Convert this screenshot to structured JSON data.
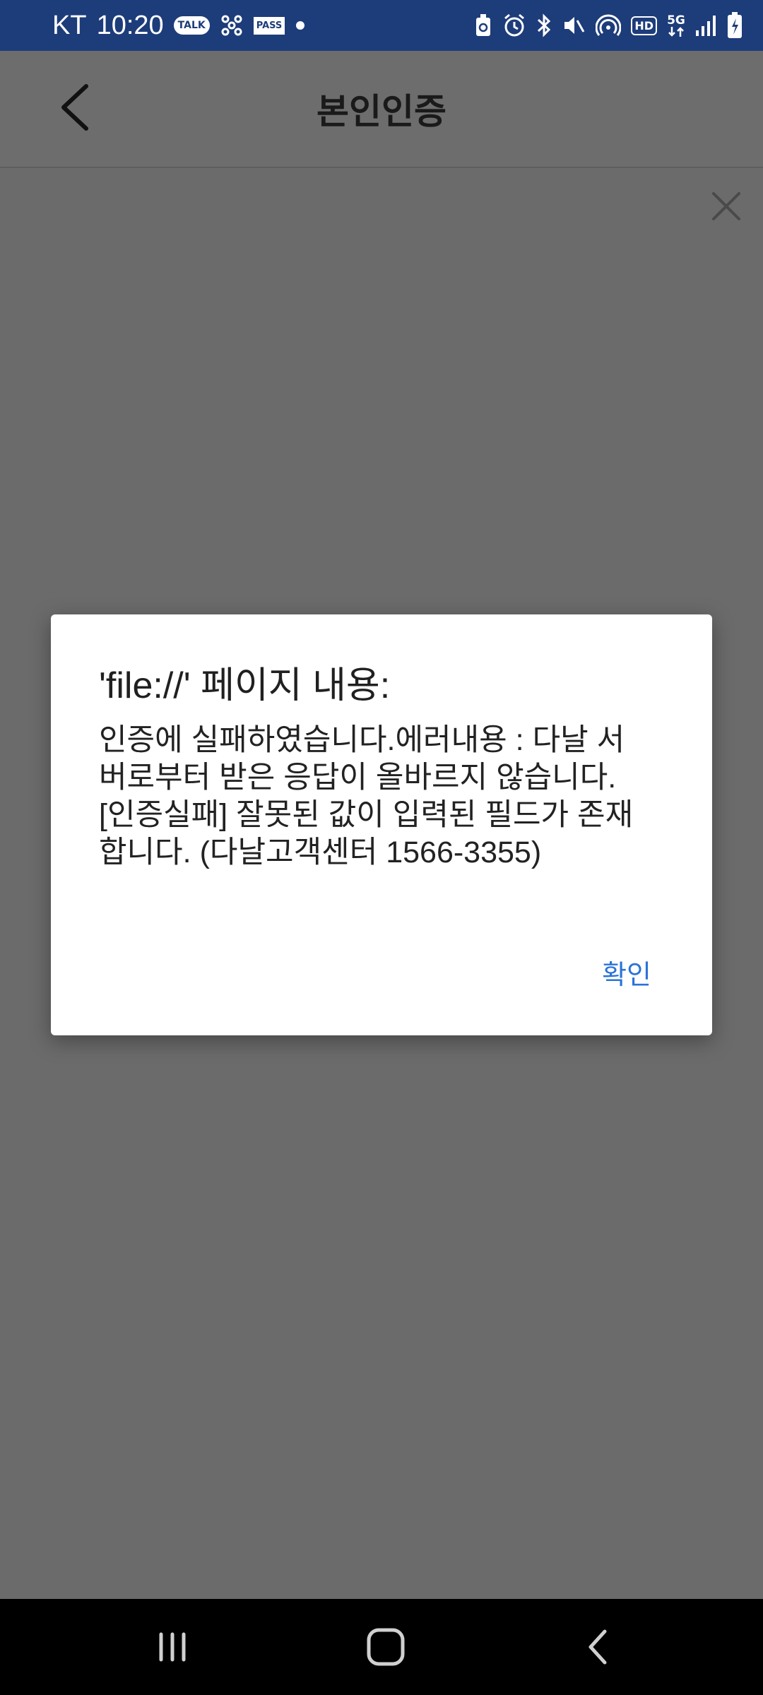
{
  "status_bar": {
    "carrier": "KT",
    "time": "10:20",
    "left_icons": [
      "kakaotalk-icon",
      "network-icon",
      "pass-icon",
      "dot-icon"
    ],
    "kakao_label": "TALK",
    "pass_label": "PASS",
    "right_icons": [
      "recycle-icon",
      "alarm-icon",
      "bluetooth-icon",
      "vibrate-icon",
      "hotspot-icon",
      "hd-icon",
      "5g-icon",
      "signal-icon",
      "battery-icon"
    ],
    "hd_label": "HD",
    "fiveg_label": "5G"
  },
  "header": {
    "title": "본인인증",
    "back_icon": "chevron-left-icon",
    "close_icon": "close-icon"
  },
  "dialog": {
    "title": "'file://' 페이지 내용:",
    "message": "인증에 실패하였습니다.에러내용 : 다날 서버로부터 받은 응답이 올바르지 않습니다.[인증실패] 잘못된 값이 입력된 필드가 존재합니다. (다날고객센터 1566-3355)",
    "ok_label": "확인"
  },
  "nav_bar": {
    "items": [
      "recent-apps-icon",
      "home-icon",
      "back-icon"
    ]
  },
  "colors": {
    "status_bar": "#1d3c7a",
    "overlay": "#6b6b6b",
    "accent": "#2a73d9"
  }
}
